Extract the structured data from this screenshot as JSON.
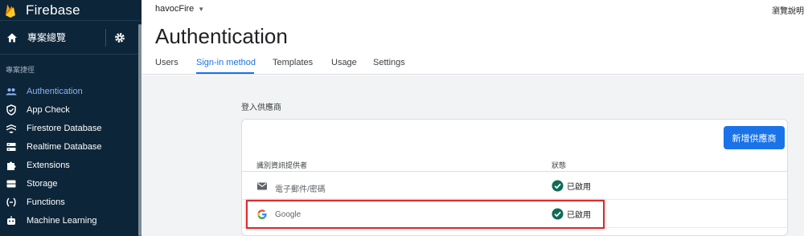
{
  "app": {
    "brand": "Firebase"
  },
  "sidebar": {
    "overview_label": "專案總覽",
    "section_label": "專案捷徑",
    "items": [
      {
        "label": "Authentication",
        "icon": "people-icon",
        "active": true
      },
      {
        "label": "App Check",
        "icon": "shield-check-icon",
        "active": false
      },
      {
        "label": "Firestore Database",
        "icon": "firestore-icon",
        "active": false
      },
      {
        "label": "Realtime Database",
        "icon": "database-icon",
        "active": false
      },
      {
        "label": "Extensions",
        "icon": "puzzle-icon",
        "active": false
      },
      {
        "label": "Storage",
        "icon": "storage-icon",
        "active": false
      },
      {
        "label": "Functions",
        "icon": "functions-icon",
        "active": false
      },
      {
        "label": "Machine Learning",
        "icon": "robot-icon",
        "active": false
      }
    ]
  },
  "header": {
    "project": "havocFire",
    "top_right": "瀏覽說明",
    "title": "Authentication"
  },
  "tabs": [
    {
      "label": "Users",
      "active": false
    },
    {
      "label": "Sign-in method",
      "active": true
    },
    {
      "label": "Templates",
      "active": false
    },
    {
      "label": "Usage",
      "active": false
    },
    {
      "label": "Settings",
      "active": false
    }
  ],
  "providers": {
    "section_title": "登入供應商",
    "add_button": "新增供應商",
    "columns": {
      "provider": "識別資訊提供者",
      "status": "狀態"
    },
    "rows": [
      {
        "name": "電子郵件/密碼",
        "icon": "email-icon",
        "status": "已啟用"
      },
      {
        "name": "Google",
        "icon": "google-icon",
        "status": "已啟用"
      }
    ]
  },
  "colors": {
    "accent": "#1a73e8",
    "sidebar_bg": "#0d2538",
    "status_check": "#0f6b57",
    "highlight": "#d32f2f"
  }
}
